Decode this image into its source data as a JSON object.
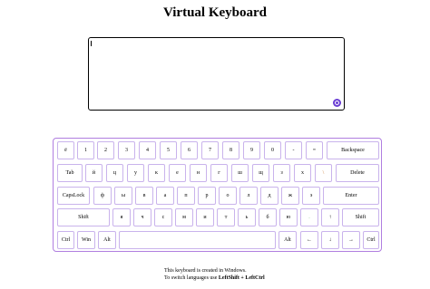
{
  "page": {
    "title": "Virtual Keyboard"
  },
  "colors": {
    "key_border": "#c9b3ec",
    "keyboard_border": "#b07ee0",
    "icon": "#6b3fd4",
    "accent_key_text": "#7ec27e"
  },
  "icons": {
    "editor_badge": "grammarly-icon"
  },
  "keyboard": {
    "rows": [
      [
        "ё",
        "1",
        "2",
        "3",
        "4",
        "5",
        "6",
        "7",
        "8",
        "9",
        "0",
        "-",
        "=",
        "Backspace"
      ],
      [
        "Tab",
        "й",
        "ц",
        "у",
        "к",
        "е",
        "н",
        "г",
        "ш",
        "щ",
        "з",
        "х",
        "\\",
        "Delete"
      ],
      [
        "CapsLock",
        "ф",
        "ы",
        "в",
        "а",
        "п",
        "р",
        "о",
        "л",
        "д",
        "ж",
        "э",
        "Enter"
      ],
      [
        "Shift",
        "я",
        "ч",
        "с",
        "м",
        "и",
        "т",
        "ь",
        "б",
        "ю",
        ".",
        "↑",
        "Shift"
      ],
      [
        "Ctrl",
        "Win",
        "Alt",
        "",
        "Alt",
        "←",
        "↓",
        "→",
        "Ctrl"
      ]
    ]
  },
  "footer": {
    "line1": "This keyboard is created in Windows.",
    "line2_prefix": "To switch languages use ",
    "line2_shortcut": "LeftShift + LeftCtrl"
  }
}
